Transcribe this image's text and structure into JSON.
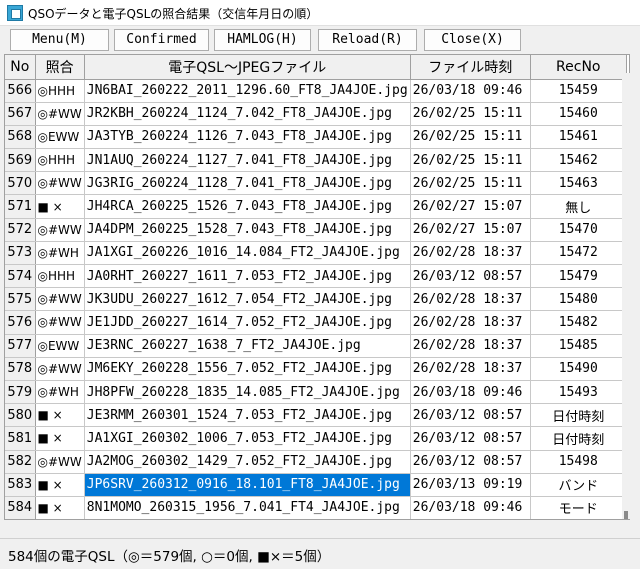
{
  "window": {
    "title": "QSOデータと電子QSLの照合結果（交信年月日の順）"
  },
  "toolbar": {
    "menu_label": "Menu(M)",
    "confirmed_label": "Confirmed",
    "hamlog_label": "HAMLOG(H)",
    "reload_label": "Reload(R)",
    "close_label": "Close(X)"
  },
  "table": {
    "columns": [
      "No",
      "照合",
      "電子QSL～JPEGファイル",
      "ファイル時刻",
      "RecNo"
    ],
    "selected_row": 17,
    "rows": [
      {
        "no": "566",
        "match": "◎HHH",
        "file": "JN6BAI_260222_2011_1296.60_FT8_JA4JOE.jpg",
        "time": "26/03/18 09:46",
        "recno": "15459"
      },
      {
        "no": "567",
        "match": "◎#WW",
        "file": "JR2KBH_260224_1124_7.042_FT8_JA4JOE.jpg",
        "time": "26/02/25 15:11",
        "recno": "15460"
      },
      {
        "no": "568",
        "match": "◎EWW",
        "file": "JA3TYB_260224_1126_7.043_FT8_JA4JOE.jpg",
        "time": "26/02/25 15:11",
        "recno": "15461"
      },
      {
        "no": "569",
        "match": "◎HHH",
        "file": "JN1AUQ_260224_1127_7.041_FT8_JA4JOE.jpg",
        "time": "26/02/25 15:11",
        "recno": "15462"
      },
      {
        "no": "570",
        "match": "◎#WW",
        "file": "JG3RIG_260224_1128_7.041_FT8_JA4JOE.jpg",
        "time": "26/02/25 15:11",
        "recno": "15463"
      },
      {
        "no": "571",
        "match": "■ ×",
        "file": "JH4RCA_260225_1526_7.043_FT8_JA4JOE.jpg",
        "time": "26/02/27 15:07",
        "recno": "無し"
      },
      {
        "no": "572",
        "match": "◎#WW",
        "file": "JA4DPM_260225_1528_7.043_FT8_JA4JOE.jpg",
        "time": "26/02/27 15:07",
        "recno": "15470"
      },
      {
        "no": "573",
        "match": "◎#WH",
        "file": "JA1XGI_260226_1016_14.084_FT2_JA4JOE.jpg",
        "time": "26/02/28 18:37",
        "recno": "15472"
      },
      {
        "no": "574",
        "match": "◎HHH",
        "file": "JA0RHT_260227_1611_7.053_FT2_JA4JOE.jpg",
        "time": "26/03/12 08:57",
        "recno": "15479"
      },
      {
        "no": "575",
        "match": "◎#WW",
        "file": "JK3UDU_260227_1612_7.054_FT2_JA4JOE.jpg",
        "time": "26/02/28 18:37",
        "recno": "15480"
      },
      {
        "no": "576",
        "match": "◎#WW",
        "file": "JE1JDD_260227_1614_7.052_FT2_JA4JOE.jpg",
        "time": "26/02/28 18:37",
        "recno": "15482"
      },
      {
        "no": "577",
        "match": "◎EWW",
        "file": "JE3RNC_260227_1638_7_FT2_JA4JOE.jpg",
        "time": "26/02/28 18:37",
        "recno": "15485"
      },
      {
        "no": "578",
        "match": "◎#WW",
        "file": "JM6EKY_260228_1556_7.052_FT2_JA4JOE.jpg",
        "time": "26/02/28 18:37",
        "recno": "15490"
      },
      {
        "no": "579",
        "match": "◎#WH",
        "file": "JH8PFW_260228_1835_14.085_FT2_JA4JOE.jpg",
        "time": "26/03/18 09:46",
        "recno": "15493"
      },
      {
        "no": "580",
        "match": "■ ×",
        "file": "JE3RMM_260301_1524_7.053_FT2_JA4JOE.jpg",
        "time": "26/03/12 08:57",
        "recno": "日付時刻"
      },
      {
        "no": "581",
        "match": "■ ×",
        "file": "JA1XGI_260302_1006_7.053_FT2_JA4JOE.jpg",
        "time": "26/03/12 08:57",
        "recno": "日付時刻"
      },
      {
        "no": "582",
        "match": "◎#WW",
        "file": "JA2MOG_260302_1429_7.052_FT2_JA4JOE.jpg",
        "time": "26/03/12 08:57",
        "recno": "15498"
      },
      {
        "no": "583",
        "match": "■ ×",
        "file": "JP6SRV_260312_0916_18.101_FT8_JA4JOE.jpg",
        "time": "26/03/13 09:19",
        "recno": "バンド"
      },
      {
        "no": "584",
        "match": "■ ×",
        "file": "8N1MOMO_260315_1956_7.041_FT4_JA4JOE.jpg",
        "time": "26/03/18 09:46",
        "recno": "モード"
      }
    ]
  },
  "status": {
    "text": "584個の電子QSL（◎＝579個, ○＝0個, ■×＝5個）"
  },
  "colors": {
    "selection": "#0078d7",
    "header_bg": "#f0f0f0",
    "grid_line": "#c8c8c8"
  }
}
